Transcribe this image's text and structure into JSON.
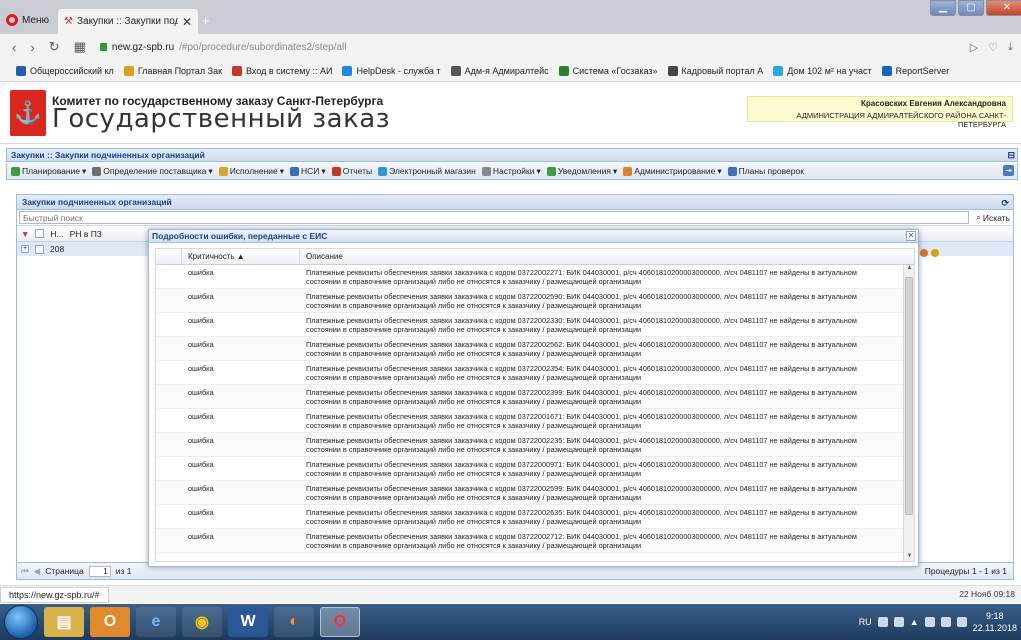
{
  "browser": {
    "menu_label": "Меню",
    "tab_title": "Закупки :: Закупки подчи",
    "tab_close": "✕",
    "new_tab": "+",
    "url_host": "new.gz-spb.ru",
    "url_path": "/#po/procedure/subordinates2/step/all",
    "bookmarks": [
      {
        "label": "Общероссийский кл",
        "color": "#1f5fae"
      },
      {
        "label": "Главная Портал Зак",
        "color": "#d9a21b"
      },
      {
        "label": "Вход в систему :: АИ",
        "color": "#c0392b"
      },
      {
        "label": "HelpDesk - служба т",
        "color": "#1e88e5"
      },
      {
        "label": "Адм-я Адмиралтейс",
        "color": "#555555"
      },
      {
        "label": "Система «Госзаказ»",
        "color": "#2e7d32"
      },
      {
        "label": "Кадровый портал А",
        "color": "#444444"
      },
      {
        "label": "Дом 102 м² на участ",
        "color": "#29a7e1"
      },
      {
        "label": "ReportServer",
        "color": "#1565c0"
      }
    ]
  },
  "site": {
    "committee": "Комитет по государственному заказу Санкт-Петербурга",
    "title": "Государственный заказ",
    "user_name": "Красовских Евгения Александровна",
    "user_org": "АДМИНИСТРАЦИЯ АДМИРАЛТЕЙСКОГО РАЙОНА САНКТ-ПЕТЕРБУРГА"
  },
  "panel": {
    "title": "Закупки :: Закупки подчиненных организаций",
    "toolbar": [
      {
        "label": "Планирование",
        "color": "#3f9b3f"
      },
      {
        "label": "Определение поставщика",
        "color": "#6d6d6d"
      },
      {
        "label": "Исполнение",
        "color": "#d7a52a"
      },
      {
        "label": "НСИ",
        "color": "#3f6fb8"
      },
      {
        "label": "Отчеты",
        "color": "#c0392b"
      },
      {
        "label": "Электронный магазин",
        "color": "#2f9ad9"
      },
      {
        "label": "Настройки",
        "color": "#888888"
      },
      {
        "label": "Уведомления",
        "color": "#3f9b3f"
      },
      {
        "label": "Администрирование",
        "color": "#d9822b"
      },
      {
        "label": "Планы проверок",
        "color": "#3f6fb8"
      }
    ]
  },
  "grid": {
    "title": "Закупки подчиненных организаций",
    "search_placeholder": "Быстрый поиск",
    "search_button": "Искать",
    "col_n": "Н...",
    "col_rn": "РН в ПЗ",
    "row_number": "208",
    "pager_label": "Страница",
    "page_current": "1",
    "page_of": "из 1",
    "pager_info": "Процедуры 1 - 1 из 1"
  },
  "dialog": {
    "title": "Подробности ошибки, переданные с ЕИС",
    "col_severity": "Критичность ▲",
    "col_description": "Описание",
    "errors": [
      {
        "severity": "ошибка",
        "code": "03722002271"
      },
      {
        "severity": "ошибка",
        "code": "03722002590"
      },
      {
        "severity": "ошибка",
        "code": "03722002330"
      },
      {
        "severity": "ошибка",
        "code": "03722002562"
      },
      {
        "severity": "ошибка",
        "code": "03722002354"
      },
      {
        "severity": "ошибка",
        "code": "03722002399"
      },
      {
        "severity": "ошибка",
        "code": "03722001671"
      },
      {
        "severity": "ошибка",
        "code": "03722002235"
      },
      {
        "severity": "ошибка",
        "code": "03722000971"
      },
      {
        "severity": "ошибка",
        "code": "03722002599"
      },
      {
        "severity": "ошибка",
        "code": "03722002635"
      },
      {
        "severity": "ошибка",
        "code": "03722002712"
      }
    ],
    "desc_prefix": "Платежные реквизиты обеспечения заявки заказчика с кодом",
    "desc_suffix": ": БИК 044030001, р/сч 40601810200003000000, л/сч 0481107 не найдены в актуальном",
    "desc_line2": "состоянии в справочнике организаций либо не относятся к заказчику / размещающей организации"
  },
  "status": {
    "url": "https://new.gz-spb.ru/#",
    "datetime": "22 Нояб 09:18"
  },
  "taskbar": {
    "lang": "RU",
    "time": "9:18",
    "date": "22.11.2018"
  }
}
